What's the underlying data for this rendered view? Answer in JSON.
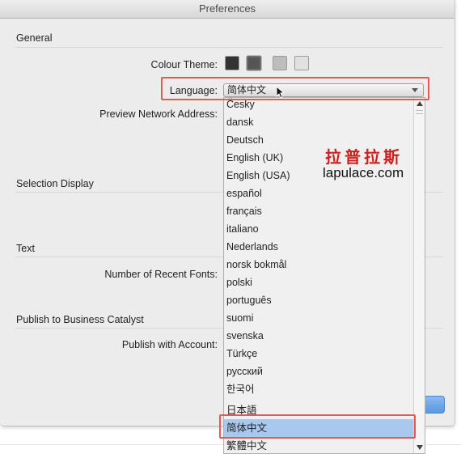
{
  "window": {
    "title": "Preferences"
  },
  "sections": {
    "general": "General",
    "selection_display": "Selection Display",
    "text": "Text",
    "publish": "Publish to Business Catalyst"
  },
  "fields": {
    "colour_theme_label": "Colour Theme:",
    "language_label": "Language:",
    "preview_network_label": "Preview Network Address:",
    "recent_fonts_label": "Number of Recent Fonts:",
    "publish_account_label": "Publish with Account:"
  },
  "colour_theme": {
    "swatches": [
      {
        "color": "#333333",
        "selected": false
      },
      {
        "color": "#555555",
        "selected": true
      },
      {
        "color": "#bdbdbd",
        "selected": false
      },
      {
        "color": "#e1e1e1",
        "selected": false
      }
    ]
  },
  "language": {
    "selected": "简体中文",
    "options": [
      "Česky",
      "dansk",
      "Deutsch",
      "English (UK)",
      "English (USA)",
      "español",
      "français",
      "italiano",
      "Nederlands",
      "norsk bokmål",
      "polski",
      "português",
      "suomi",
      "svenska",
      "Türkçe",
      "русский",
      "한국어",
      "日本語",
      "简体中文",
      "繁體中文"
    ],
    "highlighted": "简体中文"
  },
  "watermark": {
    "cn": "拉普拉斯",
    "en": "lapulace.com"
  },
  "colors": {
    "highlight": "#e05a5a",
    "selection": "#a9c8ef",
    "accent": "#5b96df"
  }
}
